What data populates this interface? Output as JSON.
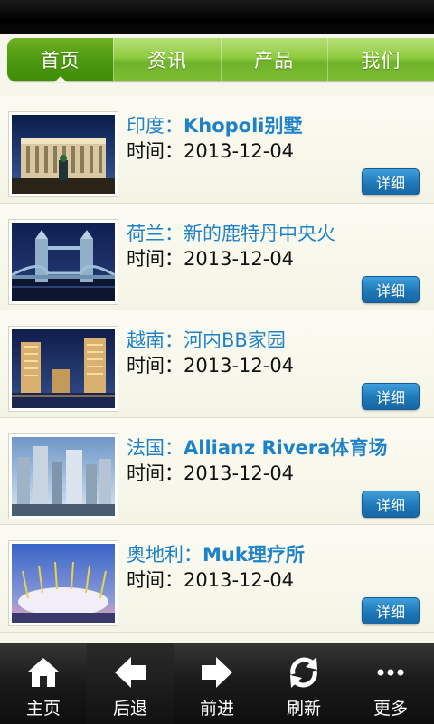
{
  "nav": {
    "tabs": [
      {
        "label": "首页",
        "active": true
      },
      {
        "label": "资讯",
        "active": false
      },
      {
        "label": "产品",
        "active": false
      },
      {
        "label": "我们",
        "active": false
      }
    ]
  },
  "list": {
    "detail_label": "详细",
    "items": [
      {
        "prefix": "印度：",
        "name": "Khopoli别墅",
        "time": "时间：2013-12-04"
      },
      {
        "prefix": "荷兰：",
        "name": "新的鹿特丹中央火",
        "time": "时间：2013-12-04"
      },
      {
        "prefix": "越南：",
        "name": "河内BB家园",
        "time": "时间：2013-12-04"
      },
      {
        "prefix": "法国：",
        "name": "Allianz Rivera体育场",
        "time": "时间：2013-12-04"
      },
      {
        "prefix": "奥地利：",
        "name": "Muk理疗所",
        "time": "时间：2013-12-04"
      }
    ]
  },
  "toolbar": {
    "buttons": [
      {
        "label": "主页",
        "icon": "home-icon"
      },
      {
        "label": "后退",
        "icon": "back-arrow-icon"
      },
      {
        "label": "前进",
        "icon": "forward-arrow-icon"
      },
      {
        "label": "刷新",
        "icon": "refresh-icon"
      },
      {
        "label": "更多",
        "icon": "more-icon"
      }
    ]
  },
  "colors": {
    "accent_green": "#6fb22a",
    "title_blue": "#1e82c8",
    "button_blue": "#1f78b8"
  }
}
